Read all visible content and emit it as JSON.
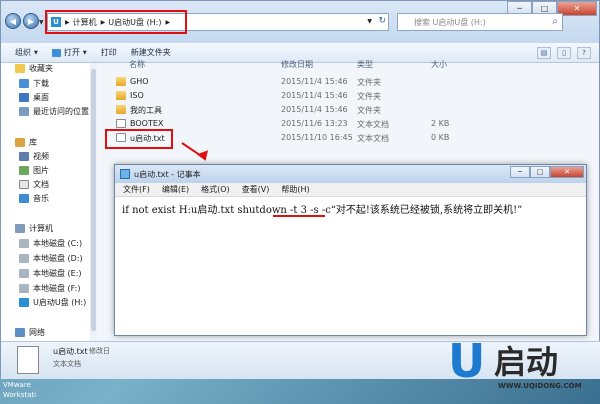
{
  "explorer": {
    "window_buttons": {
      "minimize": "─",
      "maximize": "□",
      "close": "✕"
    },
    "address": {
      "crumbs": [
        "计算机",
        "U启动U盘 (H:)"
      ],
      "refresh": "↻"
    },
    "search": {
      "placeholder": "搜索 U启动U盘 (H:)"
    },
    "toolbar": {
      "organize": "组织",
      "open": "打开",
      "print": "打印",
      "new_folder": "新建文件夹"
    },
    "nav": {
      "favorites": "收藏夹",
      "downloads": "下载",
      "desktop": "桌面",
      "recent": "最近访问的位置",
      "libraries": "库",
      "videos": "视频",
      "pictures": "图片",
      "documents": "文档",
      "music": "音乐",
      "computer": "计算机",
      "disk_c": "本地磁盘 (C:)",
      "disk_d": "本地磁盘 (D:)",
      "disk_e": "本地磁盘 (E:)",
      "disk_f": "本地磁盘 (F:)",
      "disk_h": "U启动U盘 (H:)",
      "network": "网络"
    },
    "columns": {
      "name": "名称",
      "modified": "修改日期",
      "type": "类型",
      "size": "大小"
    },
    "files": [
      {
        "name": "GHO",
        "modified": "2015/11/4 15:46",
        "type": "文件夹",
        "size": ""
      },
      {
        "name": "ISO",
        "modified": "2015/11/4 15:46",
        "type": "文件夹",
        "size": ""
      },
      {
        "name": "我的工具",
        "modified": "2015/11/4 15:46",
        "type": "文件夹",
        "size": ""
      },
      {
        "name": "BOOTEX",
        "modified": "2015/11/6 13:23",
        "type": "文本文档",
        "size": "2 KB"
      },
      {
        "name": "u启动.txt",
        "modified": "2015/11/10 16:45",
        "type": "文本文档",
        "size": "0 KB"
      }
    ],
    "status": {
      "name": "u启动.txt",
      "modified_label": "修改日",
      "type": "文本文档"
    }
  },
  "desktop": {
    "vmware_line1": "VMware",
    "vmware_line2": "Workstati"
  },
  "notepad": {
    "title": "u启动.txt - 记事本",
    "menu": [
      "文件(F)",
      "编辑(E)",
      "格式(O)",
      "查看(V)",
      "帮助(H)"
    ],
    "content": "if not exist H:u启动.txt shutdown -t 3 -s -c“对不起!该系统已经被锁,系统将立即关机!”"
  },
  "logo": {
    "cn": "启动",
    "url": "WWW.UQIDONG.COM"
  },
  "colors": {
    "highlight_red": "#e01010",
    "brand_blue": "#1e7ad0"
  }
}
